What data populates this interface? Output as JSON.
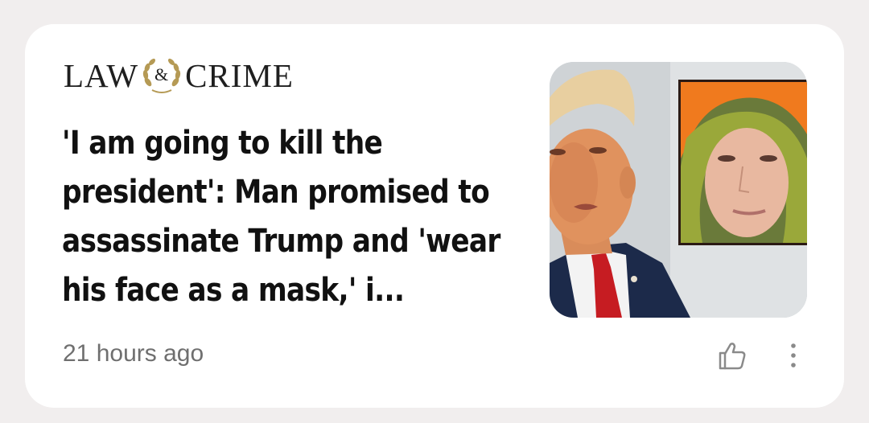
{
  "card": {
    "publisher": {
      "word_left": "LAW",
      "ampersand": "&",
      "word_right": "CRIME"
    },
    "headline": "'I am going to kill the president': Man promised to assassinate Trump and 'wear his face as a mask,' i...",
    "timestamp": "21 hours ago",
    "icons": {
      "like": "thumbs-up-icon",
      "more": "more-vertical-icon",
      "logo_wreath": "laurel-wreath-icon"
    }
  },
  "colors": {
    "page_background": "#f1eeee",
    "card_background": "#ffffff",
    "headline_text": "#111111",
    "meta_text": "#6f6f6f",
    "icon_gray": "#8a8a8a",
    "wreath_gold": "#b59a55"
  }
}
